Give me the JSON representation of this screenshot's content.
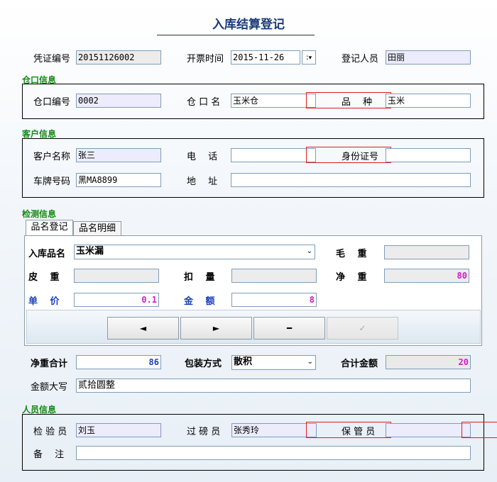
{
  "title": "入库结算登记",
  "header": {
    "voucher_label": "凭证编号",
    "voucher_value": "20151126002",
    "date_label": "开票时间",
    "date_value": "2015-11-26",
    "date_btn": ":",
    "registrar_label": "登记人员",
    "registrar_value": "田丽"
  },
  "warehouse": {
    "section": "仓口信息",
    "code_label": "仓口编号",
    "code_value": "0002",
    "name_label": "仓 口 名",
    "name_value": "玉米仓",
    "variety_label": "品　 种",
    "variety_value": "玉米"
  },
  "customer": {
    "section": "客户信息",
    "name_label": "客户名称",
    "name_value": "张三",
    "phone_label": "电　 话",
    "phone_value": "",
    "id_label": "身份证号",
    "id_value": "",
    "plate_label": "车牌号码",
    "plate_value": "黑MA8899",
    "address_label": "地　 址",
    "address_value": ""
  },
  "inspection": {
    "section": "检测信息",
    "tabs": [
      "品名登记",
      "品名明细"
    ],
    "product_label": "入库品名",
    "product_value": "玉米漏",
    "gross_label": "毛　 重",
    "gross_value": "",
    "tare_label": "皮　 重",
    "tare_value": "",
    "deduct_label": "扣　 量",
    "deduct_value": "",
    "net_label": "净　 重",
    "net_value": "80",
    "price_label": "单　 价",
    "price_value": "0.1",
    "amount_label": "金　 额",
    "amount_value": "8",
    "nav_prev": "◄",
    "nav_next": "►",
    "nav_delete": "━",
    "nav_confirm": "✓"
  },
  "summary": {
    "net_total_label": "净重合计",
    "net_total_value": "86",
    "packing_label": "包装方式",
    "packing_value": "散积",
    "total_amount_label": "合计金额",
    "total_amount_value": "20",
    "amount_words_label": "金额大写",
    "amount_words_value": "贰拾圆整"
  },
  "staff": {
    "section": "人员信息",
    "inspector_label": "检 验 员",
    "inspector_value": "刘玉",
    "weigher_label": "过 磅 员",
    "weigher_value": "张秀玲",
    "keeper_label": "保 管 员",
    "keeper_value": "",
    "remark_label": "备　 注",
    "remark_value": ""
  }
}
